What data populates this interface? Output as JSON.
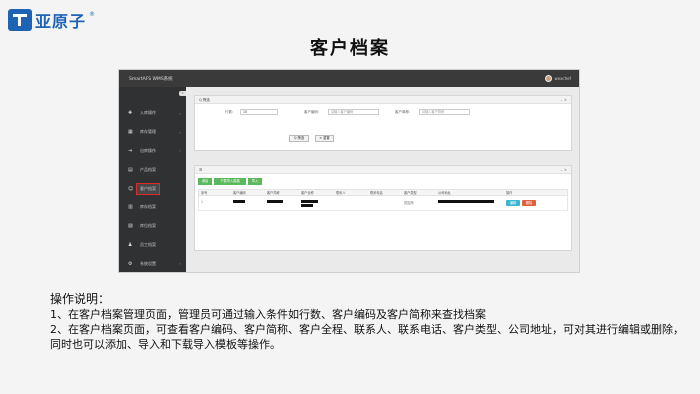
{
  "logo": {
    "text": "亚原子",
    "reg": "®"
  },
  "slide_title": "客户档案",
  "app": {
    "system_name": "SmartAFS WMS系统",
    "user_name": "wxxchef",
    "collapse_icon": "«",
    "sidebar": [
      {
        "icon": "✚",
        "label": "入库操作",
        "arrow": "›"
      },
      {
        "icon": "▦",
        "label": "库存管理",
        "arrow": "›"
      },
      {
        "icon": "⇥",
        "label": "出库操作",
        "arrow": "›"
      },
      {
        "icon": "▤",
        "label": "产品档案",
        "arrow": ""
      },
      {
        "icon": "☺",
        "label": "客户档案",
        "arrow": ""
      },
      {
        "icon": "▥",
        "label": "库存档案",
        "arrow": ""
      },
      {
        "icon": "▨",
        "label": "库位档案",
        "arrow": ""
      },
      {
        "icon": "♟",
        "label": "员工档案",
        "arrow": ""
      },
      {
        "icon": "⚙",
        "label": "系统设置",
        "arrow": "›"
      }
    ],
    "filter_panel": {
      "title": "Q 筛选",
      "controls": "⌄ ✕",
      "row_label": "行数:",
      "row_value": "15",
      "code_label": "客户编码:",
      "code_placeholder": "请输入客户编码",
      "short_label": "客户简称:",
      "short_placeholder": "请输入客户简称",
      "search_button": "Q 筛选",
      "reset_button": "✕ 重置"
    },
    "list_panel": {
      "title": "☰",
      "controls": "⌄ ✕",
      "add_button": "添加",
      "download_button": "下载导入模板",
      "import_button": "导入",
      "columns": [
        "序号",
        "客户编码",
        "客户简称",
        "客户全称",
        "联系人",
        "联系电话",
        "客户类型",
        "公司地址",
        "操作"
      ],
      "row": {
        "index": "1",
        "type": "供应商",
        "edit": "编辑",
        "delete": "删除"
      }
    }
  },
  "instructions": {
    "title": "操作说明：",
    "line1": "1、在客户档案管理页面，管理员可通过输入条件如行数、客户编码及客户简称来查找档案",
    "line2": "2、在客户档案页面，可查看客户编码、客户简称、客户全程、联系人、联系电话、客户类型、公司地址，可对其进行编辑或删除，同时也可以添加、导入和下载导入模板等操作。"
  }
}
